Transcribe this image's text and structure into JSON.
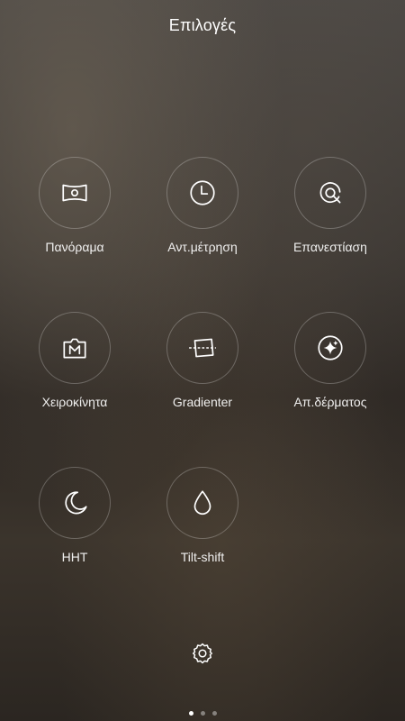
{
  "title": "Επιλογές",
  "options": [
    {
      "label": "Πανόραμα",
      "icon": "panorama-icon"
    },
    {
      "label": "Αντ.μέτρηση",
      "icon": "timer-icon"
    },
    {
      "label": "Επανεστίαση",
      "icon": "refocus-icon"
    },
    {
      "label": "Χειροκίνητα",
      "icon": "manual-icon"
    },
    {
      "label": "Gradienter",
      "icon": "gradienter-icon"
    },
    {
      "label": "Απ.δέρματος",
      "icon": "skin-smoothing-icon"
    },
    {
      "label": "HHT",
      "icon": "hht-moon-icon"
    },
    {
      "label": "Tilt-shift",
      "icon": "tilt-shift-drop-icon"
    }
  ],
  "settings": {
    "icon": "gear-icon"
  },
  "pager": {
    "pages": 3,
    "current": 1
  }
}
